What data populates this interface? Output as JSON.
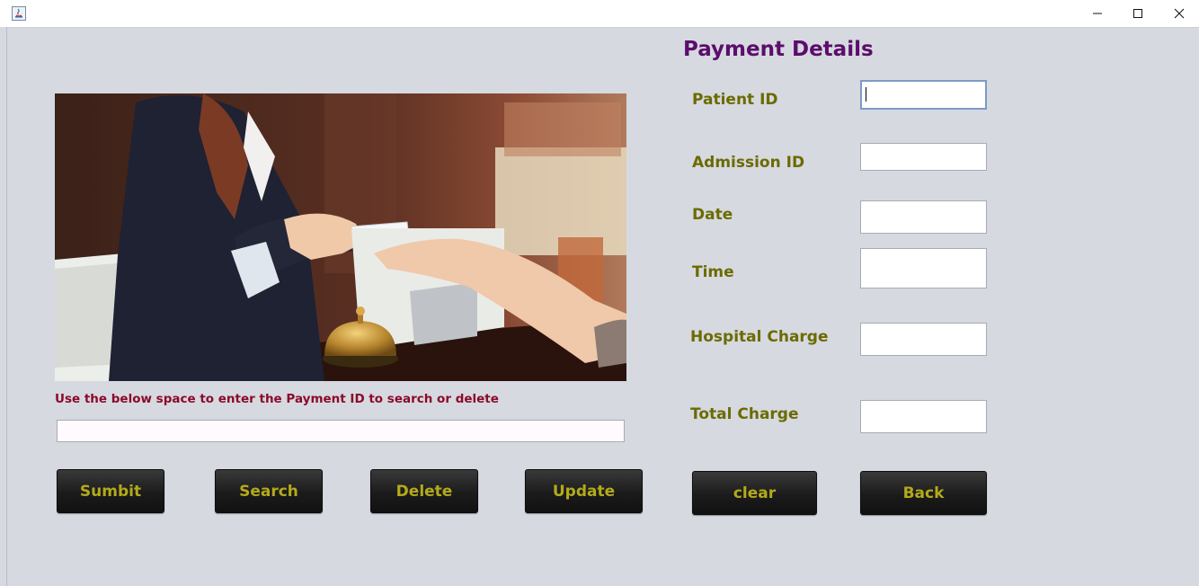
{
  "window": {
    "title": "",
    "controls": [
      "minimize-icon",
      "maximize-icon",
      "close-icon"
    ]
  },
  "form": {
    "title": "Payment Details",
    "hint": "Use the below space to enter the Payment ID to search or delete",
    "search_value": "",
    "fields": [
      {
        "label": "Patient ID",
        "value": ""
      },
      {
        "label": "Admission ID",
        "value": ""
      },
      {
        "label": "Date",
        "value": ""
      },
      {
        "label": "Time",
        "value": ""
      },
      {
        "label": "Hospital Charge",
        "value": ""
      },
      {
        "label": "Total Charge",
        "value": ""
      }
    ]
  },
  "buttons": {
    "submit": "Sumbit",
    "search": "Search",
    "delete": "Delete",
    "update": "Update",
    "clear": "clear",
    "back": "Back"
  },
  "colors": {
    "background": "#d6d9e0",
    "title": "#5b0e6b",
    "label": "#6b6b00",
    "hint": "#8b0a2a",
    "button_bg": "#1b1b1b",
    "button_text": "#b3aa1a"
  }
}
